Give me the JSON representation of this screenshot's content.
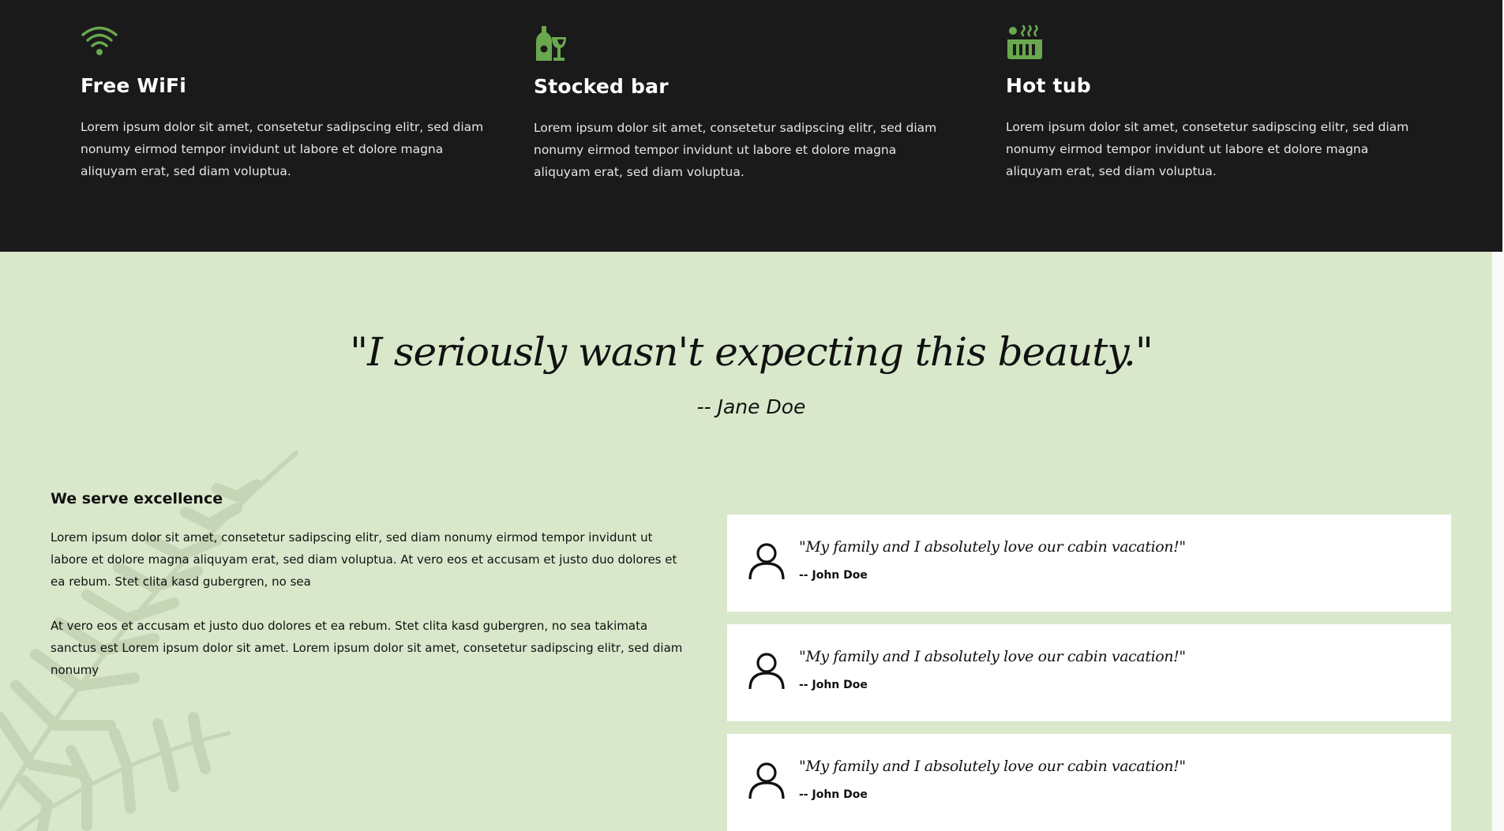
{
  "colors": {
    "accent": "#6aa84f",
    "dark_band": "#1a1a1a",
    "light_band": "#d9e8ca"
  },
  "features": [
    {
      "icon": "wifi-icon",
      "title": "Free WiFi",
      "text": "Lorem ipsum dolor sit amet, consetetur sadipscing elitr, sed diam nonumy eirmod tempor invidunt ut labore et dolore magna aliquyam erat, sed diam voluptua."
    },
    {
      "icon": "wine-bottle-glass-icon",
      "title": "Stocked bar",
      "text": "Lorem ipsum dolor sit amet, consetetur sadipscing elitr, sed diam nonumy eirmod tempor invidunt ut labore et dolore magna aliquyam erat, sed diam voluptua."
    },
    {
      "icon": "hot-tub-icon",
      "title": "Hot tub",
      "text": "Lorem ipsum dolor sit amet, consetetur sadipscing elitr, sed diam nonumy eirmod tempor invidunt ut labore et dolore magna aliquyam erat, sed diam voluptua."
    }
  ],
  "testimonial": {
    "quote": "\"I seriously wasn't expecting this beauty.\"",
    "author": "-- Jane Doe"
  },
  "excellence": {
    "title": "We serve excellence",
    "paragraphs": [
      "Lorem ipsum dolor sit amet, consetetur sadipscing elitr, sed diam nonumy eirmod tempor invidunt ut labore et dolore magna aliquyam erat, sed diam voluptua. At vero eos et accusam et justo duo dolores et ea rebum. Stet clita kasd gubergren, no sea",
      "At vero eos et accusam et justo duo dolores et ea rebum. Stet clita kasd gubergren, no sea takimata sanctus est Lorem ipsum dolor sit amet. Lorem ipsum dolor sit amet, consetetur sadipscing elitr, sed diam nonumy"
    ]
  },
  "reviews": [
    {
      "icon": "user-icon",
      "quote": "\"My family and I absolutely love our cabin vacation!\"",
      "author": "-- John Doe"
    },
    {
      "icon": "user-icon",
      "quote": "\"My family and I absolutely love our cabin vacation!\"",
      "author": "-- John Doe"
    },
    {
      "icon": "user-icon",
      "quote": "\"My family and I absolutely love our cabin vacation!\"",
      "author": "-- John Doe"
    }
  ]
}
